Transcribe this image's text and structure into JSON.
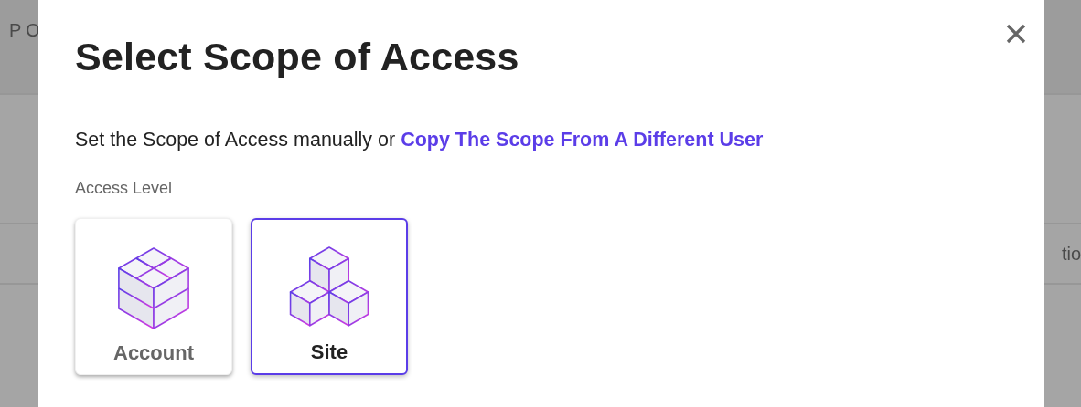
{
  "background": {
    "header_text": "PO",
    "row_text": "tio"
  },
  "dialog": {
    "title": "Select Scope of Access",
    "intro": "Set the Scope of Access manually or",
    "link": "Copy The Scope From A Different User",
    "section_label": "Access Level",
    "options": [
      {
        "label": "Account",
        "kind": "account",
        "selected": false
      },
      {
        "label": "Site",
        "kind": "site",
        "selected": true
      }
    ]
  }
}
